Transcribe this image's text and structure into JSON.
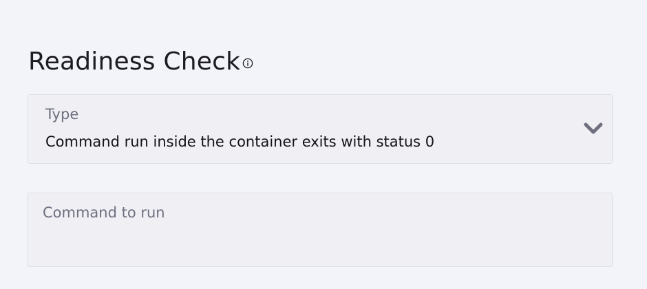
{
  "section": {
    "title": "Readiness Check",
    "info_icon": "info-circle-icon"
  },
  "type_select": {
    "label": "Type",
    "value": "Command run inside the container exits with status 0",
    "icon": "chevron-down-icon"
  },
  "command_field": {
    "label": "Command to run",
    "value": ""
  },
  "colors": {
    "background": "#f3f4f9",
    "field_background": "#efeff4",
    "field_border": "#dcdde6",
    "label": "#6e7080",
    "text": "#141418"
  }
}
